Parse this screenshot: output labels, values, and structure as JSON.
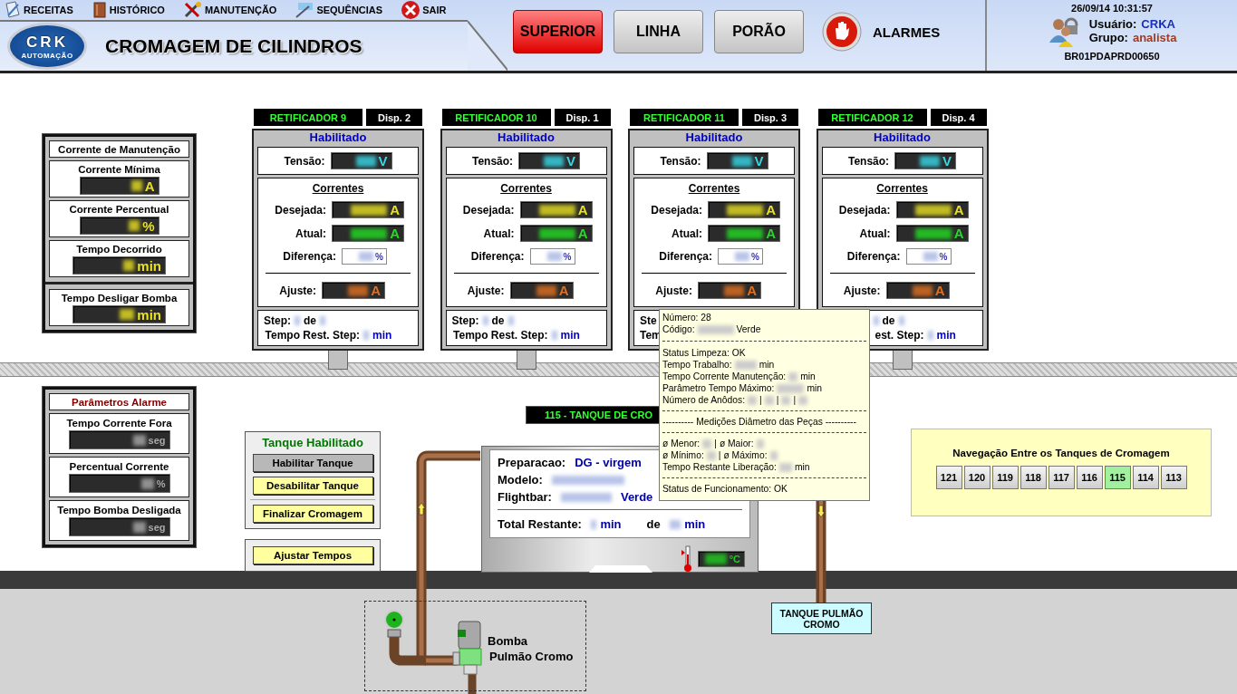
{
  "menu": [
    {
      "label": "RECEITAS"
    },
    {
      "label": "HISTÓRICO"
    },
    {
      "label": "MANUTENÇÃO"
    },
    {
      "label": "SEQUÊNCIAS"
    },
    {
      "label": "SAIR"
    }
  ],
  "logo": {
    "text": "CRK",
    "subtext": "AUTOMAÇÃO"
  },
  "title": "CROMAGEM DE CILINDROS",
  "view_buttons": [
    {
      "label": "SUPERIOR",
      "selected": true
    },
    {
      "label": "LINHA",
      "selected": false
    },
    {
      "label": "PORÃO",
      "selected": false
    }
  ],
  "alarm": {
    "label": "ALARMES"
  },
  "session": {
    "datetime": "26/09/14 10:31:57",
    "user_label": "Usuário:",
    "user": "CRKA",
    "group_label": "Grupo:",
    "group": "analista",
    "station": "BR01PDAPRD00650"
  },
  "maintenance": {
    "title": "Corrente de Manutenção",
    "fields": [
      {
        "label": "Corrente Mínima",
        "unit": "A"
      },
      {
        "label": "Corrente Percentual",
        "unit": "%"
      },
      {
        "label": "Tempo Decorrido",
        "unit": "min"
      }
    ],
    "pump_off": {
      "label": "Tempo Desligar Bomba",
      "unit": "min"
    }
  },
  "rectifiers": [
    {
      "name": "RETIFICADOR 9",
      "disp": "Disp. 2",
      "status": "Habilitado",
      "voltage": {
        "label": "Tensão:",
        "unit": "V"
      },
      "currents_title": "Correntes",
      "desired": {
        "label": "Desejada:",
        "unit": "A"
      },
      "actual": {
        "label": "Atual:",
        "unit": "A"
      },
      "difference": {
        "label": "Diferença:",
        "unit": "%"
      },
      "adjust": {
        "label": "Ajuste:",
        "unit": "A"
      },
      "step": {
        "label": "Step:",
        "of": "de"
      },
      "remaining": {
        "label": "Tempo Rest. Step:",
        "unit": "min"
      }
    },
    {
      "name": "RETIFICADOR 10",
      "disp": "Disp. 1",
      "status": "Habilitado",
      "voltage": {
        "label": "Tensão:",
        "unit": "V"
      },
      "currents_title": "Correntes",
      "desired": {
        "label": "Desejada:",
        "unit": "A"
      },
      "actual": {
        "label": "Atual:",
        "unit": "A"
      },
      "difference": {
        "label": "Diferença:",
        "unit": "%"
      },
      "adjust": {
        "label": "Ajuste:",
        "unit": "A"
      },
      "step": {
        "label": "Step:",
        "of": "de"
      },
      "remaining": {
        "label": "Tempo Rest. Step:",
        "unit": "min"
      }
    },
    {
      "name": "RETIFICADOR 11",
      "disp": "Disp. 3",
      "status": "Habilitado",
      "voltage": {
        "label": "Tensão:",
        "unit": "V"
      },
      "currents_title": "Correntes",
      "desired": {
        "label": "Desejada:",
        "unit": "A"
      },
      "actual": {
        "label": "Atual:",
        "unit": "A"
      },
      "difference": {
        "label": "Diferença:",
        "unit": "%"
      },
      "adjust": {
        "label": "Ajuste:",
        "unit": "A"
      },
      "step": {
        "label": "Ste"
      },
      "remaining": {
        "label": "Tem"
      }
    },
    {
      "name": "RETIFICADOR 12",
      "disp": "Disp. 4",
      "status": "Habilitado",
      "voltage": {
        "label": "Tensão:",
        "unit": "V"
      },
      "currents_title": "Correntes",
      "desired": {
        "label": "Desejada:",
        "unit": "A"
      },
      "actual": {
        "label": "Atual:",
        "unit": "A"
      },
      "difference": {
        "label": "Diferença:",
        "unit": "%"
      },
      "adjust": {
        "label": "Ajuste:",
        "unit": "A"
      },
      "step": {
        "of": "de"
      },
      "remaining": {
        "label": "est. Step:",
        "unit": "min"
      }
    }
  ],
  "alarm_params": {
    "title": "Parâmetros Alarme",
    "fields": [
      {
        "label": "Tempo Corrente Fora",
        "unit": "seg"
      },
      {
        "label": "Percentual Corrente",
        "unit": "%"
      },
      {
        "label": "Tempo Bomba Desligada",
        "unit": "seg"
      }
    ]
  },
  "tank_controls": {
    "status": "Tanque Habilitado",
    "buttons": [
      {
        "label": "Habilitar Tanque",
        "disabled": true
      },
      {
        "label": "Desabilitar Tanque",
        "disabled": false
      },
      {
        "label": "Finalizar Cromagem",
        "disabled": false
      }
    ],
    "adjust_button": {
      "label": "Ajustar Tempos",
      "disabled": false
    }
  },
  "tank": {
    "title": "115 - TANQUE DE CRO",
    "preparation_label": "Preparacao:",
    "preparation": "DG - virgem",
    "model_label": "Modelo:",
    "flightbar_label": "Flightbar:",
    "flightbar_color": "Verde",
    "total_label": "Total Restante:",
    "total_unit": "min",
    "of_label": "de",
    "of_unit": "min",
    "temp_unit": "°C"
  },
  "tooltip": {
    "number": "Número: 28",
    "code_label": "Código:",
    "code_color": "Verde",
    "cleaning": "Status Limpeza: OK",
    "work_time": {
      "label": "Tempo Trabalho:",
      "unit": "min"
    },
    "maint_time": {
      "label": "Tempo Corrente Manutenção:",
      "unit": "min"
    },
    "max_time": {
      "label": "Parâmetro Tempo Máximo:",
      "unit": "min"
    },
    "anodes_label": "Número de Anôdos:",
    "separator": "|",
    "measure_title": "---------- Medições Diâmetro das Peças ----------",
    "min_label": "ø Menor:",
    "max_label": "ø Maior:",
    "minimum_label": "ø Mínimo:",
    "maximum_label": "ø Máximo:",
    "release": {
      "label": "Tempo Restante Liberação:",
      "unit": "min"
    },
    "operation": "Status de Funcionamento: OK"
  },
  "navigation": {
    "title": "Navegação Entre os Tanques de Cromagem",
    "tanks": [
      {
        "label": "121",
        "selected": false
      },
      {
        "label": "120",
        "selected": false
      },
      {
        "label": "119",
        "selected": false
      },
      {
        "label": "118",
        "selected": false
      },
      {
        "label": "117",
        "selected": false
      },
      {
        "label": "116",
        "selected": false
      },
      {
        "label": "115",
        "selected": true
      },
      {
        "label": "114",
        "selected": false
      },
      {
        "label": "113",
        "selected": false
      }
    ]
  },
  "pump": {
    "label_1": "Bomba",
    "label_2": "Pulmão Cromo"
  },
  "buffer_tank": {
    "label": "TANQUE PULMÃO CROMO"
  }
}
